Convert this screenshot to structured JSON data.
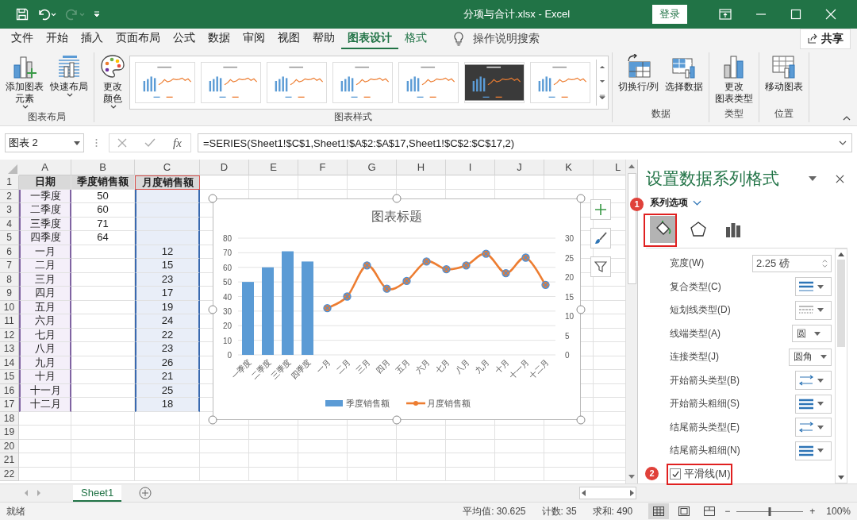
{
  "window": {
    "title": "分项与合计.xlsx  -  Excel",
    "login": "登录"
  },
  "quick_access": [
    {
      "kind": "save",
      "disabled": false
    },
    {
      "kind": "undo",
      "disabled": false
    },
    {
      "kind": "redo",
      "disabled": true
    },
    {
      "kind": "customize",
      "disabled": false
    }
  ],
  "tabs": [
    {
      "label": "文件",
      "selected": false,
      "contextual": false
    },
    {
      "label": "开始",
      "selected": false,
      "contextual": false
    },
    {
      "label": "插入",
      "selected": false,
      "contextual": false
    },
    {
      "label": "页面布局",
      "selected": false,
      "contextual": false
    },
    {
      "label": "公式",
      "selected": false,
      "contextual": false
    },
    {
      "label": "数据",
      "selected": false,
      "contextual": false
    },
    {
      "label": "审阅",
      "selected": false,
      "contextual": false
    },
    {
      "label": "视图",
      "selected": false,
      "contextual": false
    },
    {
      "label": "帮助",
      "selected": false,
      "contextual": false
    },
    {
      "label": "图表设计",
      "selected": true,
      "contextual": true
    },
    {
      "label": "格式",
      "selected": false,
      "contextual": true
    }
  ],
  "tell_me": "操作说明搜索",
  "share": "共享",
  "ribbon": [
    {
      "label": "图表布局",
      "items": [
        {
          "kind": "add-element",
          "lines": [
            "添加图表",
            "元素"
          ],
          "dropdown": true
        },
        {
          "kind": "quick-layout",
          "lines": [
            "快速布局"
          ],
          "dropdown": true
        }
      ]
    },
    {
      "label": "图表样式",
      "items": [
        {
          "kind": "change-colors",
          "lines": [
            "更改",
            "颜色"
          ],
          "dropdown": true
        },
        {
          "kind": "gallery",
          "styles": [
            {
              "kind": "light"
            },
            {
              "kind": "light"
            },
            {
              "kind": "light"
            },
            {
              "kind": "light"
            },
            {
              "kind": "light"
            },
            {
              "kind": "dark"
            },
            {
              "kind": "light"
            }
          ]
        }
      ]
    },
    {
      "label": "数据",
      "items": [
        {
          "kind": "switch-row-col",
          "lines": [
            "切换行/列"
          ],
          "dropdown": false
        },
        {
          "kind": "select-data",
          "lines": [
            "选择数据"
          ],
          "dropdown": false
        }
      ]
    },
    {
      "label": "类型",
      "items": [
        {
          "kind": "change-type",
          "lines": [
            "更改",
            "图表类型"
          ],
          "dropdown": false
        }
      ]
    },
    {
      "label": "位置",
      "items": [
        {
          "kind": "move-chart",
          "lines": [
            "移动图表"
          ],
          "dropdown": false
        }
      ]
    }
  ],
  "formula_bar": {
    "name_box": "图表 2",
    "insert_function": "fx",
    "formula": "=SERIES(Sheet1!$C$1,Sheet1!$A$2:$A$17,Sheet1!$C$2:$C$17,2)"
  },
  "sheet": {
    "columns": [
      "A",
      "B",
      "C",
      "D",
      "E",
      "F",
      "G",
      "H",
      "I",
      "J",
      "K",
      "L"
    ],
    "rows": [
      {
        "number": "1",
        "cells": [
          {
            "text": "日期",
            "bold": true
          },
          {
            "text": "季度销售额",
            "bold": true
          },
          {
            "text": "月度销售额",
            "bold": true,
            "series_name_range": true
          }
        ]
      },
      {
        "number": "2",
        "cells": [
          {
            "text": "一季度",
            "category_range": true
          },
          {
            "text": "50"
          },
          {
            "values_range": true
          }
        ]
      },
      {
        "number": "3",
        "cells": [
          {
            "text": "二季度",
            "category_range": true
          },
          {
            "text": "60"
          },
          {
            "values_range": true
          }
        ]
      },
      {
        "number": "4",
        "cells": [
          {
            "text": "三季度",
            "category_range": true
          },
          {
            "text": "71"
          },
          {
            "values_range": true
          }
        ]
      },
      {
        "number": "5",
        "cells": [
          {
            "text": "四季度",
            "category_range": true
          },
          {
            "text": "64"
          },
          {
            "values_range": true
          }
        ]
      },
      {
        "number": "6",
        "cells": [
          {
            "text": "一月",
            "category_range": true
          },
          {},
          {
            "text": "12",
            "values_range": true
          }
        ]
      },
      {
        "number": "7",
        "cells": [
          {
            "text": "二月",
            "category_range": true
          },
          {},
          {
            "text": "15",
            "values_range": true
          }
        ]
      },
      {
        "number": "8",
        "cells": [
          {
            "text": "三月",
            "category_range": true
          },
          {},
          {
            "text": "23",
            "values_range": true
          }
        ]
      },
      {
        "number": "9",
        "cells": [
          {
            "text": "四月",
            "category_range": true
          },
          {},
          {
            "text": "17",
            "values_range": true
          }
        ]
      },
      {
        "number": "10",
        "cells": [
          {
            "text": "五月",
            "category_range": true
          },
          {},
          {
            "text": "19",
            "values_range": true
          }
        ]
      },
      {
        "number": "11",
        "cells": [
          {
            "text": "六月",
            "category_range": true
          },
          {},
          {
            "text": "24",
            "values_range": true
          }
        ]
      },
      {
        "number": "12",
        "cells": [
          {
            "text": "七月",
            "category_range": true
          },
          {},
          {
            "text": "22",
            "values_range": true
          }
        ]
      },
      {
        "number": "13",
        "cells": [
          {
            "text": "八月",
            "category_range": true
          },
          {},
          {
            "text": "23",
            "values_range": true
          }
        ]
      },
      {
        "number": "14",
        "cells": [
          {
            "text": "九月",
            "category_range": true
          },
          {},
          {
            "text": "26",
            "values_range": true
          }
        ]
      },
      {
        "number": "15",
        "cells": [
          {
            "text": "十月",
            "category_range": true
          },
          {},
          {
            "text": "21",
            "values_range": true
          }
        ]
      },
      {
        "number": "16",
        "cells": [
          {
            "text": "十一月",
            "category_range": true
          },
          {},
          {
            "text": "25",
            "values_range": true
          }
        ]
      },
      {
        "number": "17",
        "cells": [
          {
            "text": "十二月",
            "category_range": true
          },
          {},
          {
            "text": "18",
            "values_range": true
          }
        ]
      },
      {
        "number": "18",
        "cells": []
      },
      {
        "number": "19",
        "cells": []
      },
      {
        "number": "20",
        "cells": []
      },
      {
        "number": "21",
        "cells": []
      },
      {
        "number": "22",
        "cells": []
      }
    ]
  },
  "chart": {
    "chart_data": {
      "type": "bar",
      "title": "图表标题",
      "categories": [
        "一季度",
        "二季度",
        "三季度",
        "四季度",
        "一月",
        "二月",
        "三月",
        "四月",
        "五月",
        "六月",
        "七月",
        "八月",
        "九月",
        "十月",
        "十一月",
        "十二月"
      ],
      "series": [
        {
          "name": "季度销售额",
          "color": "#5b9bd5",
          "values": [
            50,
            60,
            71,
            64,
            null,
            null,
            null,
            null,
            null,
            null,
            null,
            null,
            null,
            null,
            null,
            null
          ]
        },
        {
          "name": "月度销售额",
          "color": "#ed7d31",
          "type": "line",
          "axis": "y2",
          "marker": "circle",
          "values": [
            null,
            null,
            null,
            null,
            12,
            15,
            23,
            17,
            19,
            24,
            22,
            23,
            26,
            21,
            25,
            18
          ]
        }
      ],
      "grid": true,
      "legend": "bottom",
      "ylim": [
        0,
        80
      ],
      "yticks": [
        0,
        10,
        20,
        30,
        40,
        50,
        60,
        70,
        80
      ],
      "y2lim": [
        0,
        30
      ],
      "y2ticks": [
        0,
        5,
        10,
        15,
        20,
        25,
        30
      ]
    }
  },
  "pane": {
    "title": "设置数据系列格式",
    "section": "系列选项",
    "icon_tabs": [
      {
        "kind": "fill-line",
        "selected": true
      },
      {
        "kind": "effects",
        "selected": false
      },
      {
        "kind": "series-options",
        "selected": false
      }
    ],
    "properties": [
      {
        "kind": "spin",
        "label": "宽度(W)",
        "value": "2.25 磅"
      },
      {
        "kind": "compound",
        "label": "复合类型(C)"
      },
      {
        "kind": "dash",
        "label": "短划线类型(D)"
      },
      {
        "kind": "select",
        "label": "线端类型(A)",
        "value": "圆"
      },
      {
        "kind": "select",
        "label": "连接类型(J)",
        "value": "圆角"
      },
      {
        "kind": "arrow-type",
        "label": "开始箭头类型(B)"
      },
      {
        "kind": "arrow-size",
        "label": "开始箭头粗细(S)"
      },
      {
        "kind": "arrow-type",
        "label": "结尾箭头类型(E)"
      },
      {
        "kind": "arrow-size",
        "label": "结尾箭头粗细(N)"
      },
      {
        "kind": "checkbox",
        "label": "平滑线(M)",
        "checked": true
      }
    ]
  },
  "callouts": [
    {
      "number": "1"
    },
    {
      "number": "2"
    }
  ],
  "sheet_tabs": [
    {
      "label": "Sheet1",
      "selected": true
    }
  ],
  "status_bar": {
    "ready": "就绪",
    "average": "平均值: 30.625",
    "count": "计数: 35",
    "sum": "求和: 490",
    "views": [
      {
        "kind": "normal",
        "selected": true
      },
      {
        "kind": "page-layout",
        "selected": false
      },
      {
        "kind": "page-break",
        "selected": false
      }
    ],
    "zoom_out": "−",
    "zoom_in": "+",
    "zoom": {
      "level": 0.5,
      "value": "100%"
    }
  }
}
